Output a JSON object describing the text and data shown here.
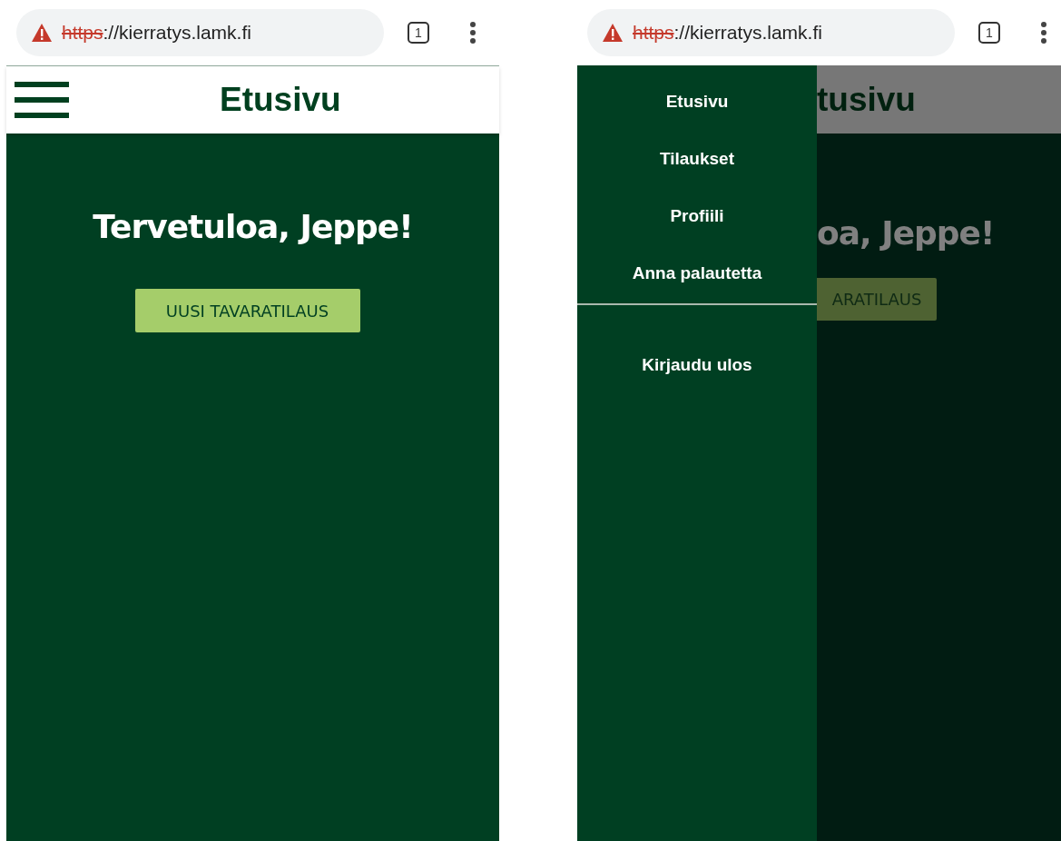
{
  "screens": [
    {
      "kind": "home",
      "browser": {
        "insecure": true,
        "scheme": "https",
        "rest": "://kierratys.lamk.fi",
        "tab_count": "1"
      },
      "header": {
        "title": "Etusivu"
      },
      "greeting": "Tervetuloa, Jeppe!",
      "button": "UUSI TAVARATILAUS"
    },
    {
      "kind": "menu",
      "browser": {
        "insecure": true,
        "scheme": "https",
        "rest": "://kierratys.lamk.fi",
        "tab_count": "1"
      },
      "drawer": {
        "items": [
          "Etusivu",
          "Tilaukset",
          "Profiili",
          "Anna palautetta"
        ],
        "footer_items": [
          "Kirjaudu ulos"
        ]
      },
      "page_behind": {
        "title": "tusivu",
        "greeting": "oa, Jeppe!",
        "button": "ARATILAUS"
      }
    }
  ]
}
